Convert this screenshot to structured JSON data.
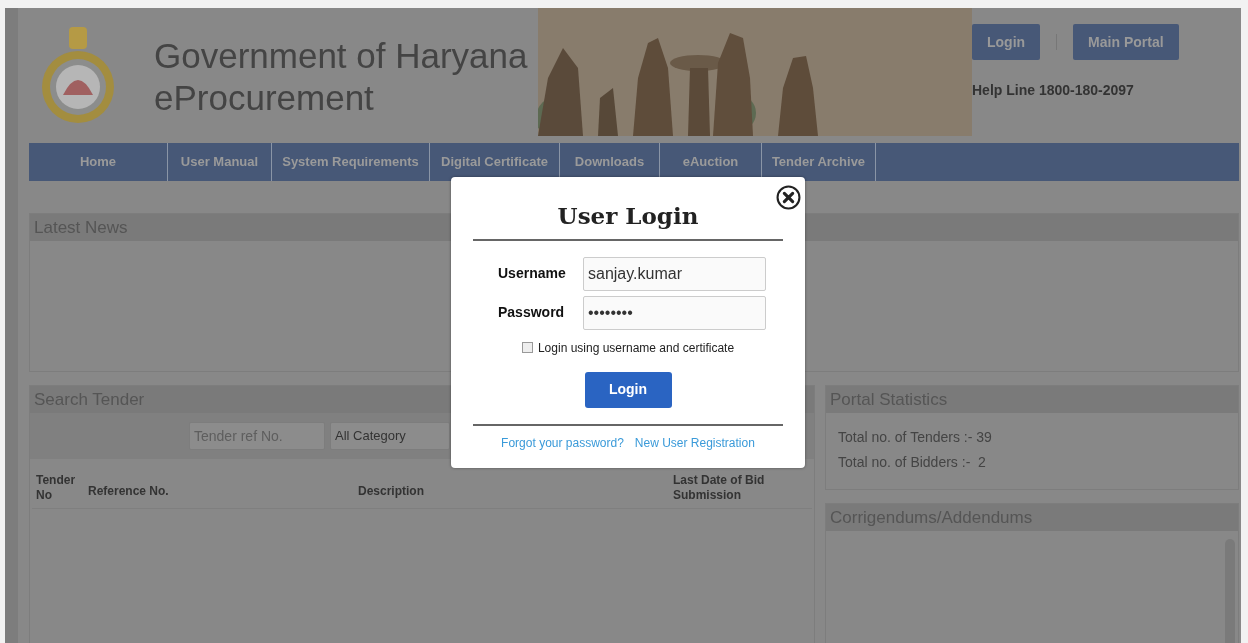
{
  "header": {
    "title_lines": [
      "Government of Haryana",
      "eProcurement"
    ],
    "buttons": [
      "Login",
      "Main Portal"
    ],
    "helpline": "Help Line 1800-180-2097"
  },
  "nav": [
    "Home",
    "User Manual",
    "System Requirements",
    "Digital Certificate",
    "Downloads",
    "eAuction",
    "Tender Archive"
  ],
  "latest_news": {
    "title": "Latest News"
  },
  "search_tender": {
    "title": "Search Tender",
    "ref_placeholder": "Tender ref No.",
    "category": "All Category",
    "columns": [
      {
        "label": "Tender No"
      },
      {
        "label": "Reference No."
      },
      {
        "label": "Description"
      },
      {
        "label": "Last Date of Bid Submission"
      }
    ]
  },
  "portal_statistics": {
    "title": "Portal Statistics",
    "lines": [
      "Total no. of Tenders :- 39",
      "Total no. of Bidders :-  2"
    ]
  },
  "corrigendums": {
    "title": "Corrigendums/Addendums"
  },
  "login_dialog": {
    "title": "User Login",
    "username_label": "Username",
    "username": "sanjay.kumar",
    "password_label": "Password",
    "password": "••••••••",
    "certificate_option": {
      "label": "Login using username and certificate",
      "checked": false
    },
    "button": "Login",
    "links": [
      "Forgot your password?",
      "New User Registration"
    ]
  }
}
